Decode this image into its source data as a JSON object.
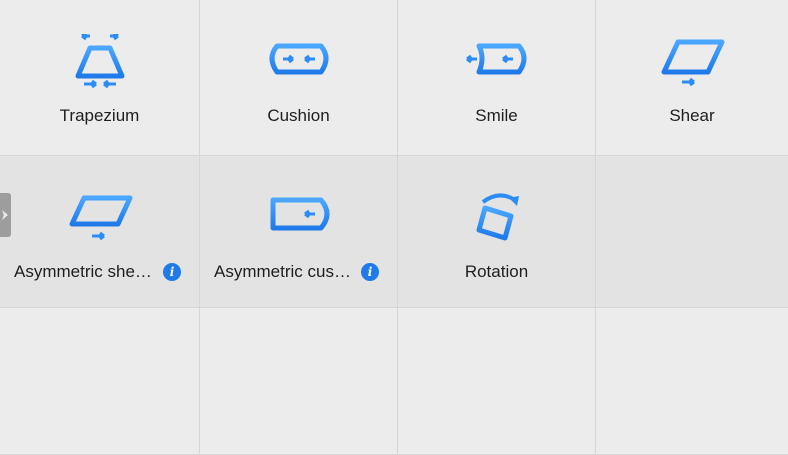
{
  "colors": {
    "accent": "#1f7bea",
    "accent_light": "#4aa6ff",
    "background": "#ececec",
    "row_highlight": "#e3e3e3"
  },
  "tiles": [
    {
      "label": "Trapezium",
      "icon": "trapezium-icon",
      "info": false
    },
    {
      "label": "Cushion",
      "icon": "cushion-icon",
      "info": false
    },
    {
      "label": "Smile",
      "icon": "smile-icon",
      "info": false
    },
    {
      "label": "Shear",
      "icon": "shear-icon",
      "info": false
    },
    {
      "label": "Asymmetric she…",
      "icon": "asymmetric-shear-icon",
      "info": true
    },
    {
      "label": "Asymmetric cus…",
      "icon": "asymmetric-cushion-icon",
      "info": true
    },
    {
      "label": "Rotation",
      "icon": "rotation-icon",
      "info": false
    }
  ],
  "info_glyph": "i"
}
